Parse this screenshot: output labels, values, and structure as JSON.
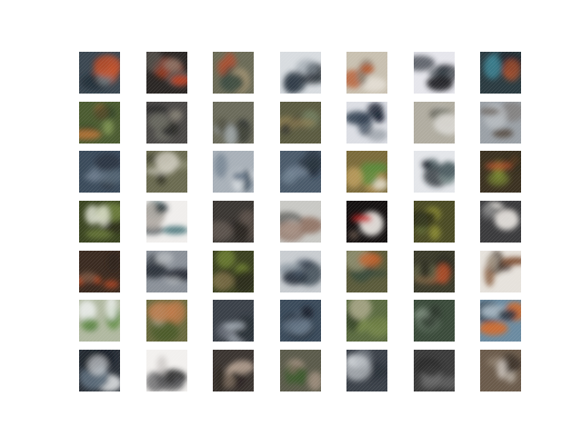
{
  "grid": {
    "rows": 7,
    "cols": 7,
    "tiles": [
      {
        "bg": "#3a4650",
        "c1": "#c8502a",
        "c2": "#1e2a30",
        "c3": "#7a8a90"
      },
      {
        "bg": "#2a2624",
        "c1": "#b8401c",
        "c2": "#5a5450",
        "c3": "#8a7a70"
      },
      {
        "bg": "#6a6a56",
        "c1": "#b84a2a",
        "c2": "#3a4a40",
        "c3": "#a09070"
      },
      {
        "bg": "#d8dce0",
        "c1": "#2a3440",
        "c2": "#1a2028",
        "c3": "#9aa2aa"
      },
      {
        "bg": "#c8c0b0",
        "c1": "#b8582a",
        "c2": "#8a8070",
        "c3": "#e8e4dc"
      },
      {
        "bg": "#e6e6ec",
        "c1": "#202026",
        "c2": "#2a3038",
        "c3": "#6a7078"
      },
      {
        "bg": "#2a3a40",
        "c1": "#b8502a",
        "c2": "#3a8090",
        "c3": "#202a30"
      },
      {
        "bg": "#4a5a30",
        "c1": "#c87a3a",
        "c2": "#2a3a20",
        "c3": "#8aa05a"
      },
      {
        "bg": "#4a4846",
        "c1": "#6a6a60",
        "c2": "#2a2a28",
        "c3": "#8a8478"
      },
      {
        "bg": "#6a6a5a",
        "c1": "#9aa0a0",
        "c2": "#4a4a3a",
        "c3": "#2a3030"
      },
      {
        "bg": "#5a5a40",
        "c1": "#8a7a50",
        "c2": "#3a3a30",
        "c3": "#7a8a6a"
      },
      {
        "bg": "#dcdee4",
        "c1": "#1a2030",
        "c2": "#2a3a4a",
        "c3": "#9aa0a8"
      },
      {
        "bg": "#b0aca0",
        "c1": "#dcdad4",
        "c2": "#4a4a40",
        "c3": "#8a8a7a"
      },
      {
        "bg": "#9aa0a6",
        "c1": "#5a5048",
        "c2": "#c0c4c8",
        "c3": "#7a7470"
      },
      {
        "bg": "#3a4a5a",
        "c1": "#6a7a8a",
        "c2": "#2a3440",
        "c3": "#5a6a78"
      },
      {
        "bg": "#6a6a50",
        "c1": "#d0ccc0",
        "c2": "#3a3a2a",
        "c3": "#8a8a70"
      },
      {
        "bg": "#a8b0b8",
        "c1": "#6a7a8a",
        "c2": "#d8dce0",
        "c3": "#4a5a6a"
      },
      {
        "bg": "#4a5a6a",
        "c1": "#2a3440",
        "c2": "#7a8a9a",
        "c3": "#1a2430"
      },
      {
        "bg": "#7a6a3a",
        "c1": "#c0a060",
        "c2": "#5a8a3a",
        "c3": "#e0dccc"
      },
      {
        "bg": "#e4e6ea",
        "c1": "#1a2028",
        "c2": "#3a4a50",
        "c3": "#7a8a8a"
      },
      {
        "bg": "#3a3020",
        "c1": "#7a8a30",
        "c2": "#b0502a",
        "c3": "#2a2a1a"
      },
      {
        "bg": "#3a4420",
        "c1": "#eceee0",
        "c2": "#6a7a3a",
        "c3": "#2a2a1a"
      },
      {
        "bg": "#f0eeec",
        "c1": "#3a6a70",
        "c2": "#2a3438",
        "c3": "#b0aaa4"
      },
      {
        "bg": "#3a3632",
        "c1": "#5a5048",
        "c2": "#2a2622",
        "c3": "#6a6058"
      },
      {
        "bg": "#c8c8c4",
        "c1": "#8a6a5a",
        "c2": "#e8e8e4",
        "c3": "#5a5a58"
      },
      {
        "bg": "#141010",
        "c1": "#c02020",
        "c2": "#e0dcd8",
        "c3": "#5a4a40"
      },
      {
        "bg": "#4a4a24",
        "c1": "#8a8a30",
        "c2": "#2a2a18",
        "c3": "#6a7a3a"
      },
      {
        "bg": "#3a3a3c",
        "c1": "#e0dcd8",
        "c2": "#2a2a2c",
        "c3": "#6a6a6c"
      },
      {
        "bg": "#3a2a20",
        "c1": "#c04a20",
        "c2": "#2a201a",
        "c3": "#6a5040"
      },
      {
        "bg": "#8a9098",
        "c1": "#2a3038",
        "c2": "#b0b4b8",
        "c3": "#4a5058"
      },
      {
        "bg": "#3a4020",
        "c1": "#6a7a30",
        "c2": "#2a2a1a",
        "c3": "#8a7a50"
      },
      {
        "bg": "#c8ccd0",
        "c1": "#4a5a6a",
        "c2": "#2a3440",
        "c3": "#8a96a0"
      },
      {
        "bg": "#5a5a3a",
        "c1": "#c8602a",
        "c2": "#3a4a3a",
        "c3": "#8a8a6a"
      },
      {
        "bg": "#3a3a2a",
        "c1": "#b8502a",
        "c2": "#2a2a1e",
        "c3": "#6a6a4a"
      },
      {
        "bg": "#e6e2dc",
        "c1": "#7a4a2a",
        "c2": "#3a2a20",
        "c3": "#a89a88"
      },
      {
        "bg": "#b0b8a0",
        "c1": "#5a8a3a",
        "c2": "#e8ece8",
        "c3": "#6a7a6a"
      },
      {
        "bg": "#6a6a40",
        "c1": "#c07a4a",
        "c2": "#4a5a2a",
        "c3": "#b0a890"
      },
      {
        "bg": "#3a4048",
        "c1": "#a0a8b0",
        "c2": "#2a3038",
        "c3": "#6a707a"
      },
      {
        "bg": "#3a4a5a",
        "c1": "#1a2430",
        "c2": "#6a7a8a",
        "c3": "#2a3440"
      },
      {
        "bg": "#5a6a40",
        "c1": "#7a8a4a",
        "c2": "#3a4a2a",
        "c3": "#a0a080"
      },
      {
        "bg": "#3a4a3a",
        "c1": "#7a8a7a",
        "c2": "#2a342a",
        "c3": "#5a6a5a"
      },
      {
        "bg": "#6a8aa0",
        "c1": "#d06a2a",
        "c2": "#2a3440",
        "c3": "#b0c0cc"
      },
      {
        "bg": "#2a3038",
        "c1": "#dcdee0",
        "c2": "#1a2028",
        "c3": "#5a6a78"
      },
      {
        "bg": "#f2f0ee",
        "c1": "#2a2a2c",
        "c2": "#5a5a5c",
        "c3": "#c8c4c0"
      },
      {
        "bg": "#3a3430",
        "c1": "#b8a494",
        "c2": "#2a2420",
        "c3": "#7a6a5a"
      },
      {
        "bg": "#5a5a4a",
        "c1": "#9a8a7a",
        "c2": "#3a5a2a",
        "c3": "#7a6a5a"
      },
      {
        "bg": "#3a4048",
        "c1": "#c8ccd0",
        "c2": "#2a3038",
        "c3": "#7a8088"
      },
      {
        "bg": "#3a3a3a",
        "c1": "#6a6a6a",
        "c2": "#2a2a2a",
        "c3": "#8a8a8a"
      },
      {
        "bg": "#6a5a4a",
        "c1": "#c8c0b8",
        "c2": "#3a3028",
        "c3": "#8a7a6a"
      }
    ]
  }
}
